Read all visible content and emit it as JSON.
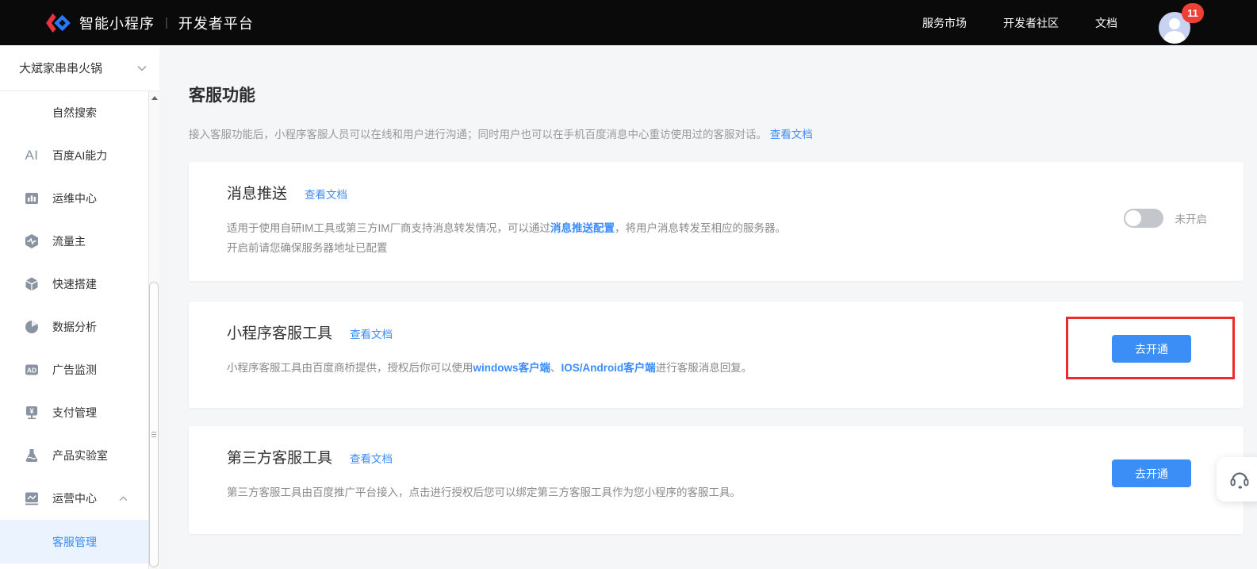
{
  "header": {
    "logo_title": "智能小程序",
    "logo_divider": "|",
    "logo_subtitle": "开发者平台",
    "nav": [
      {
        "label": "服务市场"
      },
      {
        "label": "开发者社区"
      },
      {
        "label": "文档"
      }
    ],
    "notification_count": "11"
  },
  "sidebar": {
    "app_name": "大斌家串串火锅",
    "items": [
      {
        "label": "自然搜索",
        "icon": "none"
      },
      {
        "label": "百度AI能力",
        "icon": "ai-text",
        "icon_text": "AI"
      },
      {
        "label": "运维中心",
        "icon": "bar-chart"
      },
      {
        "label": "流量主",
        "icon": "hexagon-pulse"
      },
      {
        "label": "快速搭建",
        "icon": "cube"
      },
      {
        "label": "数据分析",
        "icon": "pie-chart"
      },
      {
        "label": "广告监测",
        "icon": "ad-badge",
        "icon_text": "AD"
      },
      {
        "label": "支付管理",
        "icon": "yuan-sign",
        "icon_text": "¥"
      },
      {
        "label": "产品实验室",
        "icon": "flask"
      },
      {
        "label": "运营中心",
        "icon": "trend-chart",
        "expanded": true
      }
    ],
    "submenu_active": {
      "label": "客服管理"
    }
  },
  "main": {
    "title": "客服功能",
    "intro_text": "接入客服功能后，小程序客服人员可以在线和用户进行沟通；同时用户也可以在手机百度消息中心重访使用过的客服对话。",
    "intro_link": "查看文档",
    "cards": [
      {
        "title": "消息推送",
        "doc_link": "查看文档",
        "desc_part1": "适用于使用自研IM工具或第三方IM厂商支持消息转发情况，可以通过",
        "desc_link": "消息推送配置",
        "desc_part2": "，将用户消息转发至相应的服务器。",
        "desc_line2": "开启前请您确保服务器地址已配置",
        "toggle_state": "off",
        "toggle_label": "未开启"
      },
      {
        "title": "小程序客服工具",
        "doc_link": "查看文档",
        "desc_part1": "小程序客服工具由百度商桥提供，授权后你可以使用",
        "desc_link1": "windows客户端",
        "desc_separator": "、",
        "desc_link2": "IOS/Android客户端",
        "desc_part2": "进行客服消息回复。",
        "button_label": "去开通",
        "highlighted": true
      },
      {
        "title": "第三方客服工具",
        "doc_link": "查看文档",
        "desc": "第三方客服工具由百度推广平台接入，点击进行授权后您可以绑定第三方客服工具作为您小程序的客服工具。",
        "button_label": "去开通"
      }
    ]
  },
  "colors": {
    "header_bg": "#0a0a0a",
    "accent_blue": "#3a8ef6",
    "link_blue": "#3b8cfc",
    "active_item_bg": "#eaf3fe",
    "content_bg": "#f5f6f7",
    "card_bg": "#ffffff",
    "highlight_red": "#ec2b2b",
    "toggle_off_track": "#c3c7cd",
    "badge_red": "#ef4034",
    "avatar_bg": "#c7d3f1",
    "logo_red": "#e8343d",
    "logo_blue": "#2878ff",
    "sidebar_icon_gray": "#8a93a1"
  }
}
